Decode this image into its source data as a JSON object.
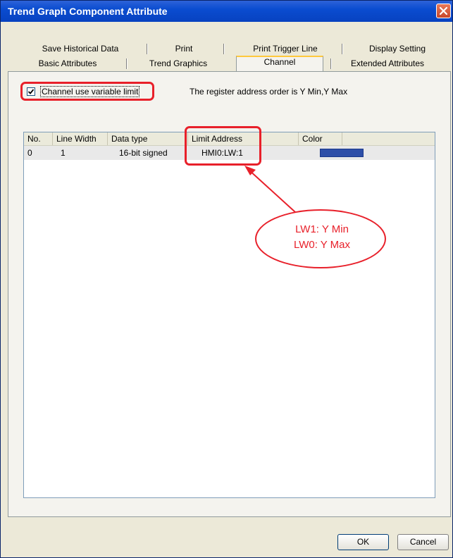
{
  "window": {
    "title": "Trend Graph Component Attribute"
  },
  "tabs": {
    "row1": [
      "Save Historical Data",
      "Print",
      "Print Trigger Line",
      "Display Setting"
    ],
    "row2": [
      "Basic Attributes",
      "Trend Graphics",
      "Channel",
      "Extended Attributes"
    ],
    "active": "Channel"
  },
  "channel": {
    "checkbox_label": "Channel use variable limit",
    "checked": true,
    "note": "The register address order is Y Min,Y Max"
  },
  "table": {
    "columns": [
      "No.",
      "Line Width",
      "Data type",
      "Limit Address",
      "Color"
    ],
    "rows": [
      {
        "no": "0",
        "line_width": "1",
        "data_type": "16-bit signed",
        "limit_address": "HMI0:LW:1",
        "color": "#2e4fa8"
      }
    ]
  },
  "callout": {
    "line1": "LW1: Y Min",
    "line2": "LW0: Y Max"
  },
  "buttons": {
    "ok": "OK",
    "cancel": "Cancel"
  },
  "colors": {
    "highlight": "#e8202a",
    "titlebar": "#0a4cd0"
  },
  "icons": {
    "close": "close-icon",
    "checkbox": "checkmark-icon",
    "arrow": "arrow-icon"
  }
}
